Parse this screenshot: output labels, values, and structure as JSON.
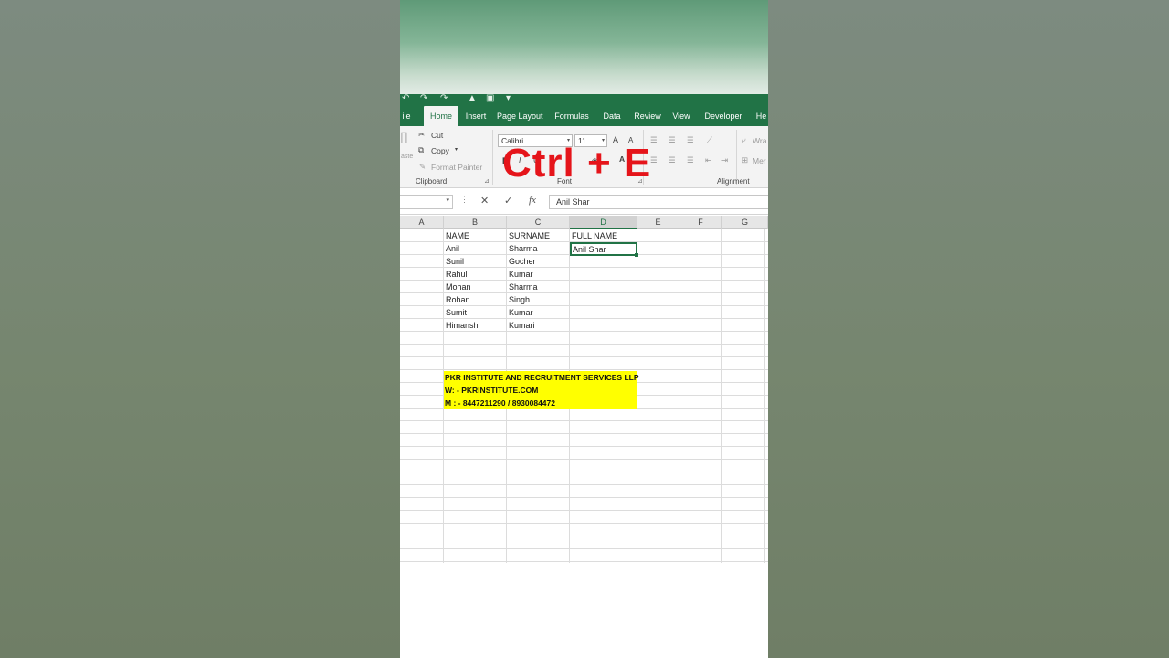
{
  "overlay_text": "Ctrl + E",
  "ribbon": {
    "tabs": [
      "ile",
      "Home",
      "Insert",
      "Page Layout",
      "Formulas",
      "Data",
      "Review",
      "View",
      "Developer",
      "He"
    ],
    "active_tab": "Home",
    "clipboard": {
      "cut": "Cut",
      "copy": "Copy",
      "format_painter": "Format Painter",
      "paste": "aste",
      "label": "Clipboard"
    },
    "font": {
      "family": "Calibri",
      "size": "11",
      "grow": "A",
      "shrink": "A",
      "italic": "I",
      "color_letter": "A",
      "label": "Font"
    },
    "alignment": {
      "wrap": "Wra",
      "merge": "Mer",
      "label": "Alignment"
    }
  },
  "formula_bar": {
    "fx": "fx",
    "cancel": "✕",
    "enter": "✓",
    "content": "Anil Shar"
  },
  "sheet": {
    "columns": [
      "A",
      "B",
      "C",
      "D",
      "E",
      "F",
      "G"
    ],
    "selected_column": "D",
    "headers": {
      "name": "NAME",
      "surname": "SURNAME",
      "full_name": "FULL NAME"
    },
    "rows": [
      {
        "name": "Anil",
        "surname": "Sharma"
      },
      {
        "name": "Sunil",
        "surname": "Gocher"
      },
      {
        "name": "Rahul",
        "surname": "Kumar"
      },
      {
        "name": "Mohan",
        "surname": "Sharma"
      },
      {
        "name": "Rohan",
        "surname": "Singh"
      },
      {
        "name": "Sumit",
        "surname": "Kumar"
      },
      {
        "name": "Himanshi",
        "surname": "Kumari"
      }
    ],
    "active_cell_value": "Anil Shar"
  },
  "banner": {
    "line1": "PKR INSTITUTE AND RECRUITMENT SERVICES LLP",
    "line2": "W: - PKRINSTITUTE.COM",
    "line3": "M : - 8447211290 / 8930084472"
  },
  "colors": {
    "excel_green": "#217346",
    "overlay_red": "#e5141a",
    "banner_yellow": "#ffff00"
  }
}
